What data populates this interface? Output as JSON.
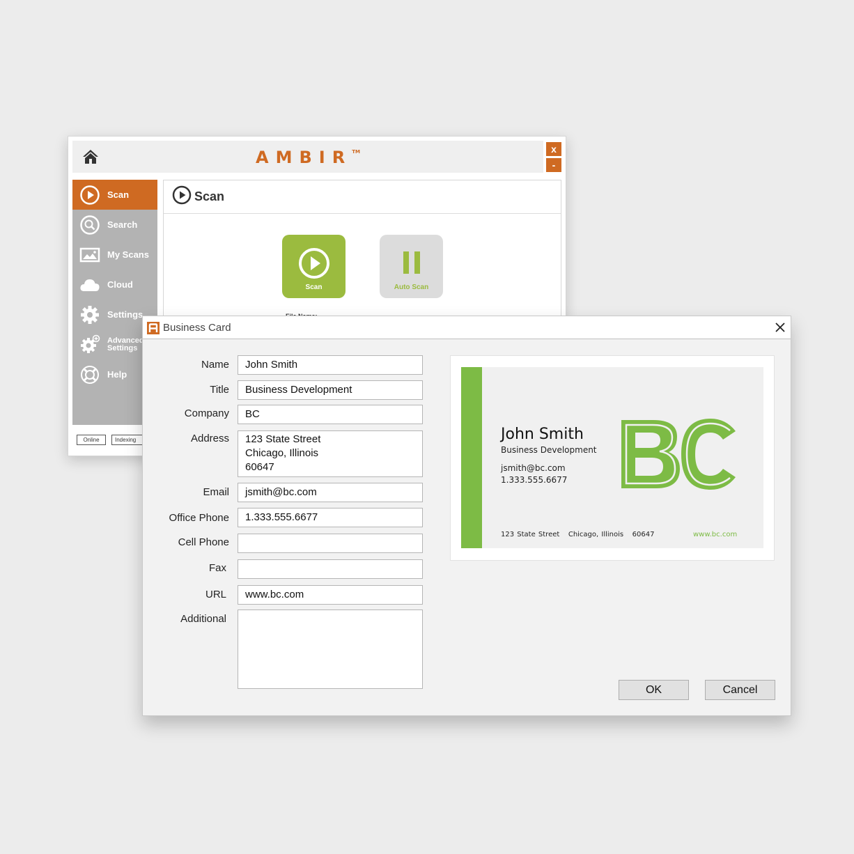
{
  "app": {
    "brand": "AMBIR",
    "brand_tm": "TM",
    "close_label": "x",
    "minimize_label": "-",
    "colors": {
      "accent": "#cf6a22",
      "green": "#9bbb3f",
      "sidebar": "#b3b3b3"
    }
  },
  "sidebar": {
    "items": [
      {
        "label": "Scan",
        "icon": "play-circle-icon",
        "active": true
      },
      {
        "label": "Search",
        "icon": "search-icon"
      },
      {
        "label": "My Scans",
        "icon": "image-icon"
      },
      {
        "label": "Cloud",
        "icon": "cloud-icon"
      },
      {
        "label": "Settings",
        "icon": "gear-icon"
      },
      {
        "label_line1": "Advanced",
        "label_line2": "Settings",
        "icon": "gear-plus-icon"
      },
      {
        "label": "Help",
        "icon": "lifebuoy-icon"
      }
    ]
  },
  "status": {
    "online": "Online",
    "indexing": "Indexing"
  },
  "content": {
    "title": "Scan",
    "scan_button": "Scan",
    "auto_scan_button": "Auto Scan",
    "file_name_label": "File Name:"
  },
  "dialog": {
    "title": "Business Card",
    "fields": [
      {
        "label": "Name",
        "value": "John Smith"
      },
      {
        "label": "Title",
        "value": "Business Development"
      },
      {
        "label": "Company",
        "value": "BC"
      },
      {
        "label": "Address",
        "value": "123 State Street\nChicago, Illinois\n60647"
      },
      {
        "label": "Email",
        "value": "jsmith@bc.com"
      },
      {
        "label": "Office Phone",
        "value": "1.333.555.6677"
      },
      {
        "label": "Cell Phone",
        "value": ""
      },
      {
        "label": "Fax",
        "value": ""
      },
      {
        "label": "URL",
        "value": "www.bc.com"
      },
      {
        "label": "Additional",
        "value": ""
      }
    ],
    "ok_label": "OK",
    "cancel_label": "Cancel"
  },
  "card_preview": {
    "name": "John Smith",
    "title": "Business Development",
    "email": "jsmith@bc.com",
    "phone": "1.333.555.6677",
    "address": "123 State Street   Chicago, Illinois   60647",
    "url": "www.bc.com",
    "logo_text": "BC",
    "colors": {
      "green": "#7dbb45",
      "card_bg": "#f0f0f0"
    }
  }
}
